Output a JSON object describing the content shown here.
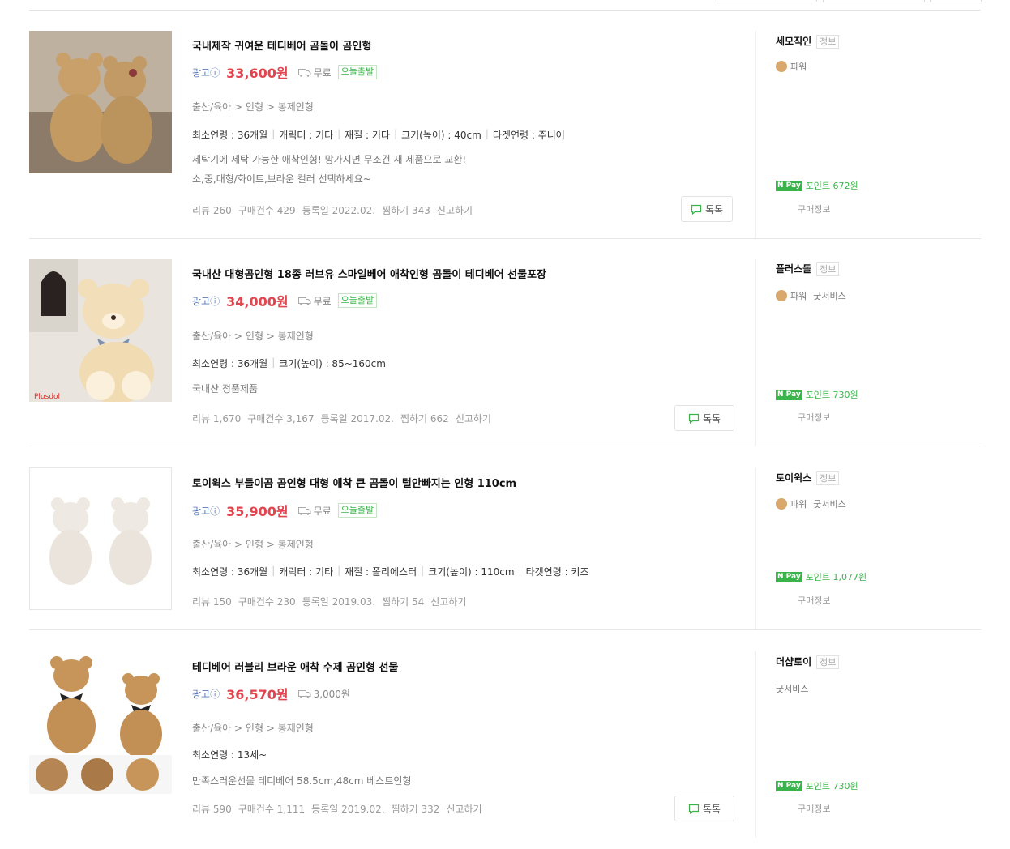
{
  "products": [
    {
      "title": "국내제작 귀여운 테디베어 곰돌이 곰인형",
      "ad_label": "광고ⓘ",
      "price": "33,600원",
      "shipping": "무료",
      "today_badge": "오늘출발",
      "category": [
        "출산/육아",
        "인형",
        "봉제인형"
      ],
      "attrs": [
        "최소연령 : 36개월",
        "캐릭터 : 기타",
        "재질 : 기타",
        "크기(높이) : 40cm",
        "타겟연령 : 주니어"
      ],
      "desc_lines": [
        "세탁기에 세탁 가능한 애착인형! 망가지면 무조건 새 제품으로 교환!",
        "소,중,대형/화이트,브라운 컬러 선택하세요~"
      ],
      "meta": {
        "review": "리뷰 260",
        "purchases": "구매건수 429",
        "registered": "등록일 2022.02.",
        "wish": "찜하기 343",
        "report": "신고하기"
      },
      "talk": "톡톡",
      "mall": "세모직인",
      "mall_info": "정보",
      "grade": "파워",
      "point": "포인트 672원",
      "purchase_info": "구매정보"
    },
    {
      "title": "국내산 대형곰인형 18종 러브유 스마일베어 애착인형 곰돌이 테디베어 선물포장",
      "ad_label": "광고ⓘ",
      "price": "34,000원",
      "shipping": "무료",
      "today_badge": "오늘출발",
      "category": [
        "출산/육아",
        "인형",
        "봉제인형"
      ],
      "attrs": [
        "최소연령 : 36개월",
        "크기(높이) : 85~160cm"
      ],
      "desc_lines": [
        "국내산 정품제품"
      ],
      "meta": {
        "review": "리뷰 1,670",
        "purchases": "구매건수 3,167",
        "registered": "등록일 2017.02.",
        "wish": "찜하기 662",
        "report": "신고하기"
      },
      "talk": "톡톡",
      "mall": "플러스돌",
      "mall_info": "정보",
      "grade": "파워",
      "grade_extra": "굿서비스",
      "point": "포인트 730원",
      "purchase_info": "구매정보",
      "thumb_logo": "Plusdol"
    },
    {
      "title": "토이윅스 부들이곰 곰인형 대형 애착 큰 곰돌이 털안빠지는 인형 110cm",
      "ad_label": "광고ⓘ",
      "price": "35,900원",
      "shipping": "무료",
      "today_badge": "오늘출발",
      "category": [
        "출산/육아",
        "인형",
        "봉제인형"
      ],
      "attrs": [
        "최소연령 : 36개월",
        "캐릭터 : 기타",
        "재질 : 폴리에스터",
        "크기(높이) : 110cm",
        "타겟연령 : 키즈"
      ],
      "desc_lines": [],
      "meta": {
        "review": "리뷰 150",
        "purchases": "구매건수 230",
        "registered": "등록일 2019.03.",
        "wish": "찜하기 54",
        "report": "신고하기"
      },
      "talk": "",
      "mall": "토이윅스",
      "mall_info": "정보",
      "grade": "파워",
      "grade_extra": "굿서비스",
      "point": "포인트 1,077원",
      "purchase_info": "구매정보"
    },
    {
      "title": "테디베어 러블리 브라운 애착 수제 곰인형 선물",
      "ad_label": "광고ⓘ",
      "price": "36,570원",
      "shipping": "3,000원",
      "today_badge": "",
      "category": [
        "출산/육아",
        "인형",
        "봉제인형"
      ],
      "attrs": [
        "최소연령 : 13세~"
      ],
      "desc_lines": [
        "만족스러운선물 테디베어 58.5cm,48cm 베스트인형"
      ],
      "meta": {
        "review": "리뷰 590",
        "purchases": "구매건수 1,111",
        "registered": "등록일 2019.02.",
        "wish": "찜하기 332",
        "report": "신고하기"
      },
      "talk": "톡톡",
      "mall": "더샵토이",
      "mall_info": "정보",
      "grade": "",
      "grade_extra": "굿서비스",
      "point": "포인트 730원",
      "purchase_info": "구매정보"
    }
  ],
  "colors": {
    "price": "#e3454f",
    "ad": "#5b7ab5",
    "green": "#3ab44a",
    "muted": "#999999"
  },
  "icons": [
    "truck-icon",
    "chat-bubble-icon",
    "medal-icon",
    "npay-icon"
  ]
}
